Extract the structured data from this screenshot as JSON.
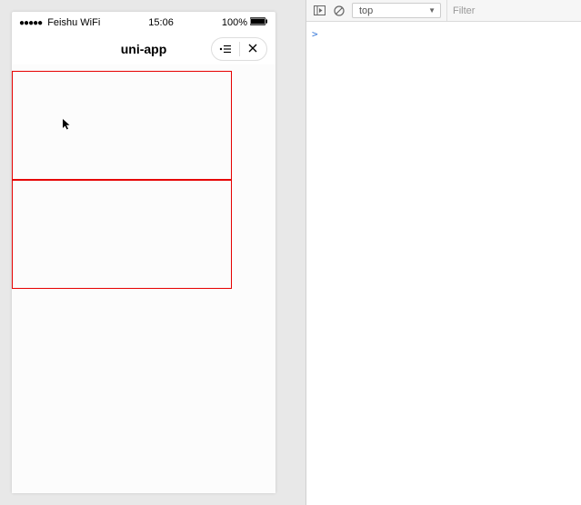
{
  "simulator": {
    "status": {
      "signal": "●●●●●",
      "carrier": "Feishu WiFi",
      "time": "15:06",
      "battery_percent": "100%"
    },
    "nav": {
      "title": "uni-app",
      "capsule_menu_label": "menu",
      "capsule_close_label": "close"
    }
  },
  "devtools": {
    "context_selector": "top",
    "filter_placeholder": "Filter",
    "prompt": ">"
  }
}
